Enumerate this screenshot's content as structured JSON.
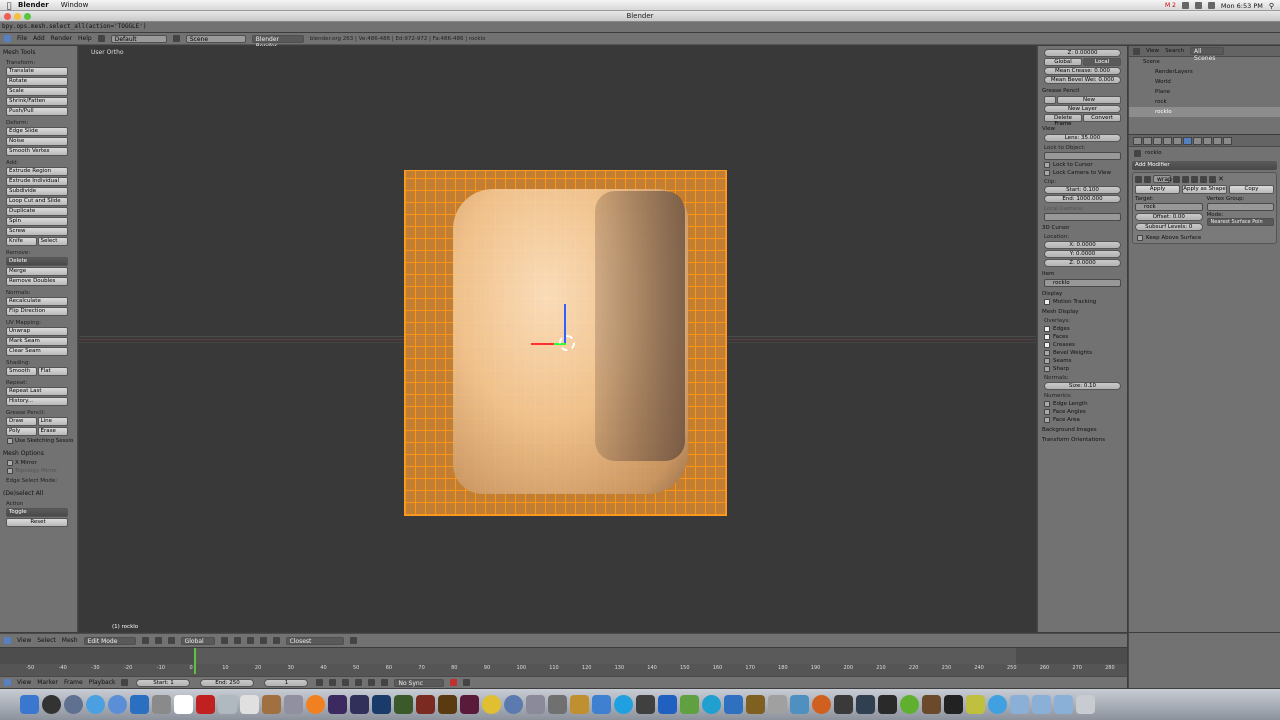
{
  "mac_menu": {
    "app": "Blender",
    "items": [
      "Window"
    ],
    "clock": "Mon 6:53 PM",
    "status_text": "M 2"
  },
  "window": {
    "title": "Blender"
  },
  "info_log": {
    "text": "bpy.ops.mesh.select_all(action='TOGGLE')"
  },
  "top_header": {
    "menus": [
      "File",
      "Add",
      "Render",
      "Help"
    ],
    "layout": "Default",
    "scene": "Scene",
    "engine": "Blender Render",
    "stats": "blender.org 263 | Ve:486-486 | Ed:972-972 | Fa:486-486 | rocklo"
  },
  "toolshelf": {
    "title": "Mesh Tools",
    "sections": [
      {
        "label": "Transform:",
        "buttons": [
          "Translate",
          "Rotate",
          "Scale",
          "Shrink/Fatten",
          "Push/Pull"
        ]
      },
      {
        "label": "Deform:",
        "buttons": [
          "Edge Slide",
          "Noise",
          "Smooth Vertex"
        ]
      },
      {
        "label": "Add:",
        "buttons": [
          "Extrude Region",
          "Extrude Individual",
          "Subdivide",
          "Loop Cut and Slide",
          "Duplicate",
          "Spin",
          "Screw"
        ],
        "pair": [
          "Knife",
          "Select"
        ]
      },
      {
        "label": "Remove:",
        "dark": "Delete",
        "buttons": [
          "Merge",
          "Remove Doubles"
        ]
      },
      {
        "label": "Normals:",
        "buttons": [
          "Recalculate",
          "Flip Direction"
        ]
      },
      {
        "label": "UV Mapping:",
        "buttons": [
          "Unwrap",
          "Mark Seam",
          "Clear Seam"
        ]
      },
      {
        "label": "Shading:",
        "pair": [
          "Smooth",
          "Flat"
        ]
      },
      {
        "label": "Repeat:",
        "buttons": [
          "Repeat Last",
          "History..."
        ]
      },
      {
        "label": "Grease Pencil:",
        "pair": [
          "Draw",
          "Line"
        ],
        "pair2": [
          "Poly",
          "Erase"
        ],
        "check": "Use Sketching Sessio"
      }
    ],
    "mesh_options": {
      "title": "Mesh Options",
      "x_mirror": "X Mirror",
      "topology_mirror": "Topology Mirror",
      "edge_select_mode": "Edge Select Mode:"
    },
    "operator": {
      "title": "(De)select All",
      "action_label": "Action",
      "action_value": "Toggle",
      "reset": "Reset"
    }
  },
  "viewport": {
    "view_label": "User Ortho",
    "object_label": "(1) rocklo"
  },
  "npanel": {
    "z_field": "Z: 0.00000",
    "global": "Global",
    "local": "Local",
    "mean_crease": "Mean Crease: 0.000",
    "mean_bevel": "Mean Bevel Wei: 0.000",
    "grease_pencil": {
      "title": "Grease Pencil",
      "new": "New",
      "new_layer": "New Layer",
      "delete_frame": "Delete Frame",
      "convert": "Convert"
    },
    "view": {
      "title": "View",
      "lens": "Lens: 35.000",
      "lock_to_object": "Lock to Object:",
      "lock_to_cursor": "Lock to Cursor",
      "lock_camera": "Lock Camera to View",
      "clip": "Clip:",
      "start": "Start: 0.100",
      "end": "End: 1000.000",
      "local_camera": "Local Camera:"
    },
    "cursor": {
      "title": "3D Cursor",
      "location": "Location:",
      "x": "X: 0.0000",
      "y": "Y: 0.0000",
      "z": "Z: 0.0000"
    },
    "item": {
      "title": "Item",
      "name": "rocklo"
    },
    "display": {
      "title": "Display"
    },
    "motion_tracking": "Motion Tracking",
    "mesh_display": {
      "title": "Mesh Display",
      "overlays": "Overlays:",
      "checks_on": [
        "Edges",
        "Faces",
        "Creases"
      ],
      "checks_off": [
        "Bevel Weights",
        "Seams",
        "Sharp"
      ],
      "normals": "Normals:",
      "size": "Size: 0.10",
      "numerics": "Numerics:",
      "numerics_checks": [
        "Edge Length",
        "Face Angles",
        "Face Area"
      ]
    },
    "background_images": "Background Images",
    "transform_orientations": "Transform Orientations"
  },
  "outliner": {
    "menus": [
      "View",
      "Search"
    ],
    "filter": "All Scenes",
    "rows": [
      "Scene",
      "RenderLayers",
      "World",
      "Plane",
      "rock",
      "rocklo"
    ]
  },
  "properties": {
    "path": "rocklo",
    "add_modifier": "Add Modifier",
    "modifier_name": "wrap",
    "apply": "Apply",
    "apply_as_shape": "Apply as Shape",
    "copy": "Copy",
    "target_label": "Target:",
    "target_value": "rock",
    "vertex_group_label": "Vertex Group:",
    "offset": "Offset: 0.00",
    "mode_label": "Mode:",
    "subsurf": "Subsurf Levels: 0",
    "mode_value": "Nearest Surface Poin",
    "keep_above": "Keep Above Surface"
  },
  "viewport_header": {
    "menus": [
      "View",
      "Select",
      "Mesh"
    ],
    "mode": "Edit Mode",
    "orientation": "Global",
    "snap": "Closest"
  },
  "timeline": {
    "ticks": [
      "-50",
      "-40",
      "-30",
      "-20",
      "-10",
      "0",
      "10",
      "20",
      "30",
      "40",
      "50",
      "60",
      "70",
      "80",
      "90",
      "100",
      "110",
      "120",
      "130",
      "140",
      "150",
      "160",
      "170",
      "180",
      "190",
      "200",
      "210",
      "220",
      "230",
      "240",
      "250",
      "260",
      "270",
      "280"
    ],
    "menus": [
      "View",
      "Marker",
      "Frame",
      "Playback"
    ],
    "start": "Start: 1",
    "end": "End: 250",
    "current": "1",
    "sync": "No Sync"
  },
  "colors": {
    "accent": "#ff9b22",
    "active_blue": "#5680c2",
    "panel": "#727272",
    "viewport_bg": "#393939"
  }
}
